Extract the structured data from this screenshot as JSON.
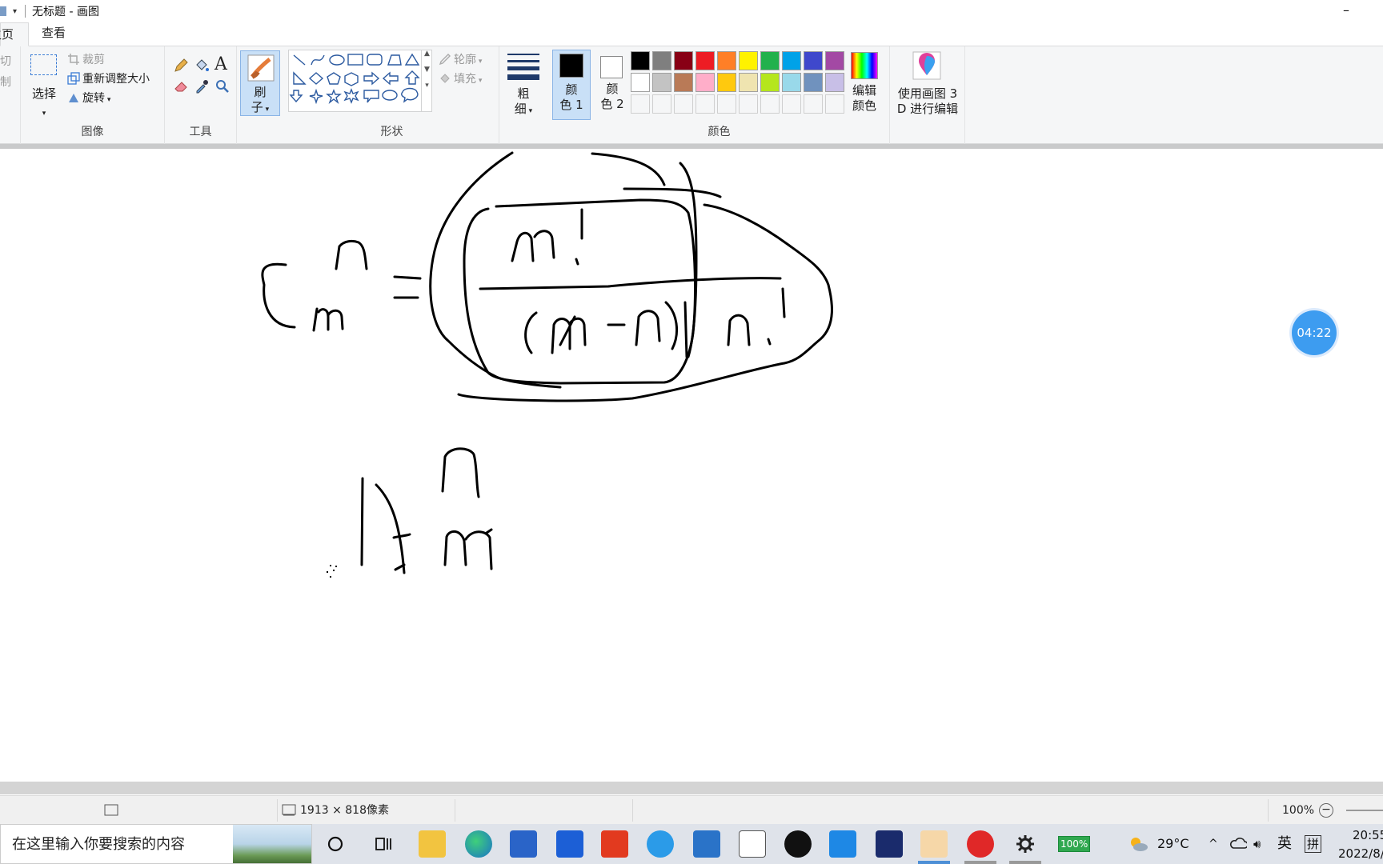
{
  "window": {
    "title": "无标题 - 画图",
    "minimize": "–"
  },
  "tabs": {
    "home": "主页",
    "view": "查看"
  },
  "ribbon": {
    "clipboard": {
      "cut": "切",
      "copy": "制"
    },
    "image": {
      "select": "选择",
      "crop": "裁剪",
      "resize": "重新调整大小",
      "rotate": "旋转",
      "group_label": "图像"
    },
    "tools": {
      "group_label": "工具"
    },
    "brush": {
      "label_1": "刷",
      "label_2": "子"
    },
    "shapes": {
      "outline": "轮廓",
      "fill": "填充",
      "group_label": "形状"
    },
    "size": {
      "label_1": "粗",
      "label_2": "细"
    },
    "colors": {
      "color1_1": "颜",
      "color1_2": "色 1",
      "color2_1": "颜",
      "color2_2": "色 2",
      "edit_colors_1": "编辑",
      "edit_colors_2": "颜色",
      "group_label": "颜色",
      "color1_value": "#000000",
      "color2_value": "#ffffff",
      "palette_row1": [
        "#000000",
        "#7f7f7f",
        "#880015",
        "#ed1c24",
        "#ff7f27",
        "#fff200",
        "#22b14c",
        "#00a2e8",
        "#3f48cc",
        "#a349a4"
      ],
      "palette_row2": [
        "#ffffff",
        "#c3c3c3",
        "#b97a57",
        "#ffaec9",
        "#ffc90e",
        "#efe4b0",
        "#b5e61d",
        "#99d9ea",
        "#7092be",
        "#c8bfe7"
      ]
    },
    "paint3d": {
      "line1": "使用画图 3",
      "line2": "D 进行编辑"
    }
  },
  "timer": "04:22",
  "status": {
    "size": "1913 × 818像素",
    "zoom": "100%"
  },
  "taskbar": {
    "search_placeholder": "在这里输入你要搜索的内容",
    "battery": "100%",
    "weather": "29°C",
    "ime_lang": "英",
    "ime_mode": "拼",
    "time": "20:55",
    "date": "2022/8/"
  }
}
